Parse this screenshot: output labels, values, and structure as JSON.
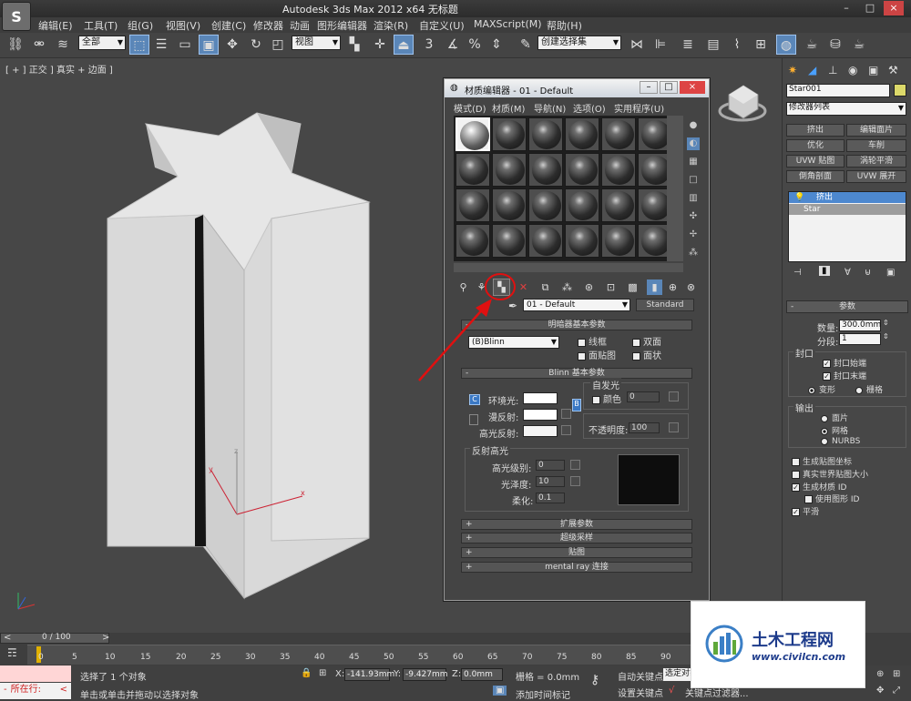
{
  "app": {
    "title": "Autodesk 3ds Max  2012 x64    无标题",
    "logo": "S",
    "window_buttons": [
      "–",
      "□",
      "×"
    ]
  },
  "menu": [
    "编辑(E)",
    "工具(T)",
    "组(G)",
    "视图(V)",
    "创建(C)",
    "修改器",
    "动画",
    "图形编辑器",
    "渲染(R)",
    "自定义(U)",
    "MAXScript(M)",
    "帮助(H)"
  ],
  "toolbar": {
    "selection_filter": "全部",
    "ref_coord": "视图",
    "snap_value": "3",
    "named_selection": "创建选择集"
  },
  "viewport": {
    "label": "[ + ] 正交 ] 真实 + 边面 ]",
    "axis_x": "x",
    "axis_z": "z",
    "axis_y": "y"
  },
  "material_editor": {
    "title": "材质编辑器 - 01 - Default",
    "menu": [
      "模式(D)",
      "材质(M)",
      "导航(N)",
      "选项(O)",
      "实用程序(U)"
    ],
    "material_name": "01 - Default",
    "material_type": "Standard",
    "shader_rollout": "明暗器基本参数",
    "shader": "(B)Blinn",
    "shader_opts": [
      "线框",
      "双面",
      "面贴图",
      "面状"
    ],
    "blinn_rollout": "Blinn 基本参数",
    "self_illum_label": "自发光",
    "color_label": "颜色",
    "self_illum_value": "0",
    "ambient": "环境光:",
    "diffuse": "漫反射:",
    "specular": "高光反射:",
    "opacity_label": "不透明度:",
    "opacity": "100",
    "spec_highlights": "反射高光",
    "spec_level_label": "高光级别:",
    "spec_level": "0",
    "gloss_label": "光泽度:",
    "gloss": "10",
    "soften_label": "柔化:",
    "soften": "0.1",
    "collapsed_rollouts": [
      "扩展参数",
      "超级采样",
      "贴图",
      "mental ray 连接"
    ],
    "ambient_lock": "C",
    "diffuse_map": "B"
  },
  "command_panel": {
    "object_name": "Star001",
    "modifier_list": "修改器列表",
    "modifier_buttons": [
      "挤出",
      "编辑面片",
      "优化",
      "车削",
      "UVW 贴图",
      "涡轮平滑",
      "倒角剖面",
      "UVW 展开"
    ],
    "stack": [
      "挤出",
      "Star"
    ],
    "params_rollout": "参数",
    "amount_label": "数量:",
    "amount": "300.0mm",
    "segments_label": "分段:",
    "segments": "1",
    "capping": "封口",
    "cap_start": "封口始端",
    "cap_end": "封口末端",
    "morph": "变形",
    "grid": "栅格",
    "output": "输出",
    "out_patch": "面片",
    "out_mesh": "网格",
    "out_nurbs": "NURBS",
    "gen_map_coords": "生成贴图坐标",
    "real_world": "真实世界贴图大小",
    "gen_mat_ids": "生成材质 ID",
    "use_shape_ids": "使用图形 ID",
    "smooth": "平滑"
  },
  "timeline": {
    "frame_counter": "0 / 100",
    "ticks": [
      "0",
      "5",
      "10",
      "15",
      "20",
      "25",
      "30",
      "35",
      "40",
      "45",
      "50",
      "55",
      "60",
      "65",
      "70",
      "75",
      "80",
      "85",
      "90"
    ]
  },
  "status": {
    "script_label": "所在行:",
    "selection_text": "选择了 1 个对象",
    "prompt_text": "单击或单击并拖动以选择对象",
    "x_label": "X:",
    "x_value": "-141.93mm",
    "y_label": "Y:",
    "y_value": "-9.427mm",
    "z_label": "Z:",
    "z_value": "0.0mm",
    "grid": "栅格 = 0.0mm",
    "add_time_tag": "添加时间标记",
    "auto_key": "自动关键点",
    "set_key": "设置关键点",
    "selected": "选定对象",
    "key_filters": "关键点过滤器..."
  },
  "watermark": {
    "brand": "土木工程网",
    "url": "www.civilcn.com"
  },
  "colors": {
    "highlight_blue": "#5a86b8",
    "annotation_red": "#e01010",
    "object_gray": "#d8d8d8",
    "viewport_bg": "#474747"
  }
}
